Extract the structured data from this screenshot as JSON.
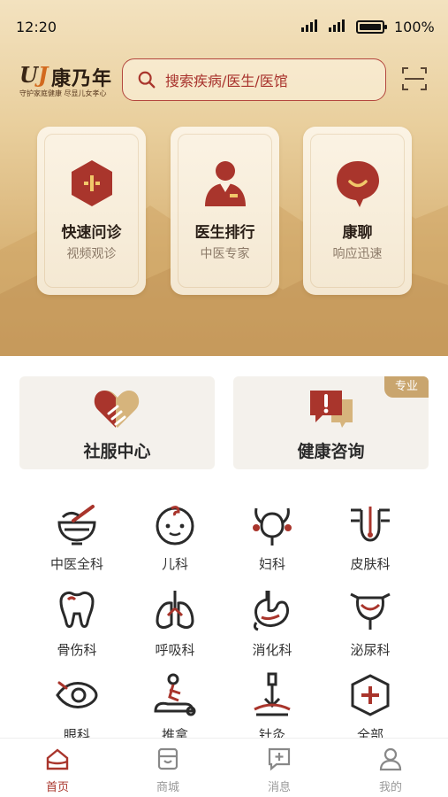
{
  "status_bar": {
    "time": "12:20",
    "battery": "100%"
  },
  "header": {
    "logo_mark": "U",
    "logo_mark_j": "J",
    "logo_name": "康乃年",
    "logo_slogan": "守护家庭健康 尽显儿女孝心",
    "search_placeholder": "搜索疾病/医生/医馆"
  },
  "feature_cards": [
    {
      "title": "快速问诊",
      "subtitle": "视频观诊",
      "icon": "plus-hexagon-icon"
    },
    {
      "title": "医生排行",
      "subtitle": "中医专家",
      "icon": "doctor-icon"
    },
    {
      "title": "康聊",
      "subtitle": "响应迅速",
      "icon": "chat-smile-icon"
    }
  ],
  "big_buttons": [
    {
      "title": "社服中心",
      "icon": "heart-hand-icon"
    },
    {
      "title": "健康咨询",
      "icon": "alert-chat-icon",
      "tag": "专业"
    }
  ],
  "departments": [
    {
      "label": "中医全科",
      "icon": "mortar-icon"
    },
    {
      "label": "儿科",
      "icon": "baby-icon"
    },
    {
      "label": "妇科",
      "icon": "uterus-icon"
    },
    {
      "label": "皮肤科",
      "icon": "skin-icon"
    },
    {
      "label": "骨伤科",
      "icon": "tooth-bone-icon"
    },
    {
      "label": "呼吸科",
      "icon": "lungs-icon"
    },
    {
      "label": "消化科",
      "icon": "stomach-icon"
    },
    {
      "label": "泌尿科",
      "icon": "bladder-icon"
    },
    {
      "label": "眼科",
      "icon": "eye-icon"
    },
    {
      "label": "推拿",
      "icon": "massage-icon"
    },
    {
      "label": "针灸",
      "icon": "acupuncture-icon"
    },
    {
      "label": "全部",
      "icon": "plus-octagon-icon"
    }
  ],
  "tabbar": [
    {
      "label": "首页",
      "icon": "home-icon",
      "active": true
    },
    {
      "label": "商城",
      "icon": "shop-icon",
      "active": false
    },
    {
      "label": "消息",
      "icon": "message-icon",
      "active": false
    },
    {
      "label": "我的",
      "icon": "user-icon",
      "active": false
    }
  ],
  "colors": {
    "accent": "#a9352c",
    "gold": "#c9a56e",
    "dark": "#2a2a2a"
  }
}
